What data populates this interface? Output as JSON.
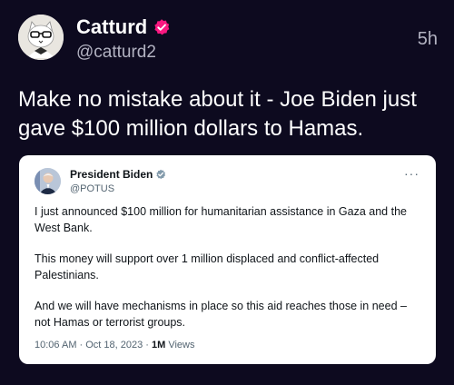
{
  "post": {
    "display_name": "Catturd",
    "handle": "@catturd2",
    "time": "5h",
    "text": "Make no mistake about it - Joe Biden just gave $100 million dollars to Hamas.",
    "verified_color": "#f91880"
  },
  "quote": {
    "display_name": "President Biden",
    "handle": "@POTUS",
    "more_label": "···",
    "paragraphs": [
      "I just announced $100 million for humanitarian assistance in Gaza and the West Bank.",
      "This money will support over 1 million displaced and conflict-affected Palestinians.",
      "And we will have mechanisms in place so this aid reaches those in need – not Hamas or terrorist groups."
    ],
    "timestamp": "10:06 AM · Oct 18, 2023 · ",
    "views_count": "1M",
    "views_label": " Views",
    "verified_color": "#829aab"
  }
}
